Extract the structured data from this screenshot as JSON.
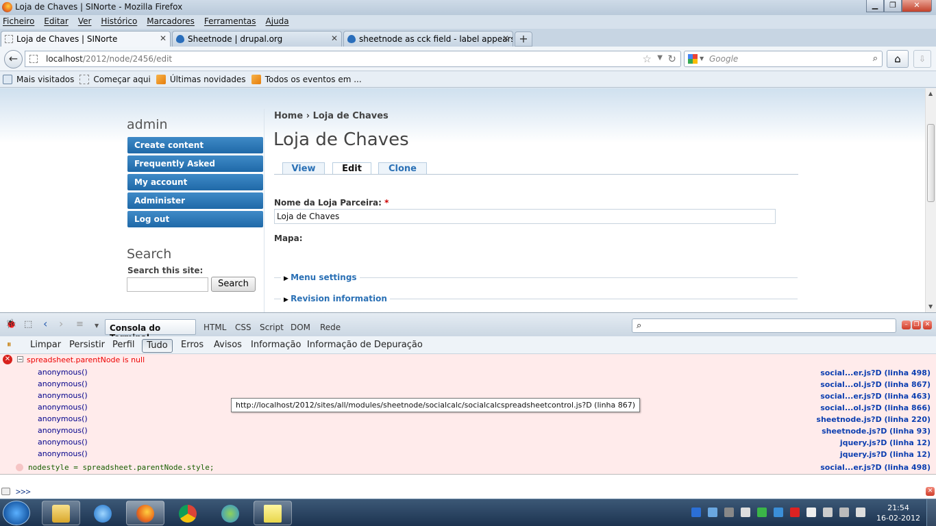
{
  "window": {
    "title": "Loja de Chaves | SINorte - Mozilla Firefox"
  },
  "menubar": [
    "Ficheiro",
    "Editar",
    "Ver",
    "Histórico",
    "Marcadores",
    "Ferramentas",
    "Ajuda"
  ],
  "tabs": [
    {
      "label": "Loja de Chaves | SINorte",
      "active": true
    },
    {
      "label": "Sheetnode | drupal.org",
      "active": false
    },
    {
      "label": "sheetnode as cck field - label appears...",
      "active": false
    }
  ],
  "nav": {
    "url_host": "localhost",
    "url_path": "/2012/node/2456/edit",
    "search_placeholder": "Google"
  },
  "bookmarks": [
    "Mais visitados",
    "Começar aqui",
    "Últimas novidades",
    "Todos os eventos em ..."
  ],
  "sidebar": {
    "user_title": "admin",
    "links": [
      "Create content",
      "Frequently Asked Questions",
      "My account",
      "Administer",
      "Log out"
    ],
    "search_title": "Search",
    "search_label": "Search this site:",
    "search_button": "Search"
  },
  "main": {
    "breadcrumb": "Home › Loja de Chaves",
    "title": "Loja de Chaves",
    "tabs": [
      "View",
      "Edit",
      "Clone"
    ],
    "field_label": "Nome da Loja Parceira:",
    "required_mark": "*",
    "field_value": "Loja de Chaves",
    "map_label": "Mapa:",
    "fieldsets": [
      "Menu settings",
      "Revision information"
    ]
  },
  "firebug": {
    "panel_select": "Consola do Terminal",
    "panels": [
      "HTML",
      "CSS",
      "Script",
      "DOM",
      "Rede"
    ],
    "toolbar": [
      "Limpar",
      "Persistir",
      "Perfil",
      "Tudo",
      "Erros",
      "Avisos",
      "Informação",
      "Informação de Depuração"
    ],
    "error_message": "spreadsheet.parentNode is null",
    "stack": [
      {
        "fn": "anonymous()",
        "src": "social...er.js?D (linha 498)"
      },
      {
        "fn": "anonymous()",
        "src": "social...ol.js?D (linha 867)"
      },
      {
        "fn": "anonymous()",
        "src": "social...er.js?D (linha 463)"
      },
      {
        "fn": "anonymous()",
        "src": "social...ol.js?D (linha 866)"
      },
      {
        "fn": "anonymous()",
        "src": "sheetnode.js?D (linha 220)"
      },
      {
        "fn": "anonymous()",
        "src": "sheetnode.js?D (linha 93)"
      },
      {
        "fn": "anonymous()",
        "src": "jquery.js?D (linha 12)"
      },
      {
        "fn": "anonymous()",
        "src": "jquery.js?D (linha 12)"
      }
    ],
    "code_line": "nodestyle = spreadsheet.parentNode.style;",
    "code_src": "social...er.js?D (linha 498)",
    "tooltip": "http://localhost/2012/sites/all/modules/sheetnode/socialcalc/socialcalcspreadsheetcontrol.js?D (linha 867)",
    "prompt": ">>>"
  },
  "taskbar": {
    "time": "21:54",
    "date": "16-02-2012"
  }
}
